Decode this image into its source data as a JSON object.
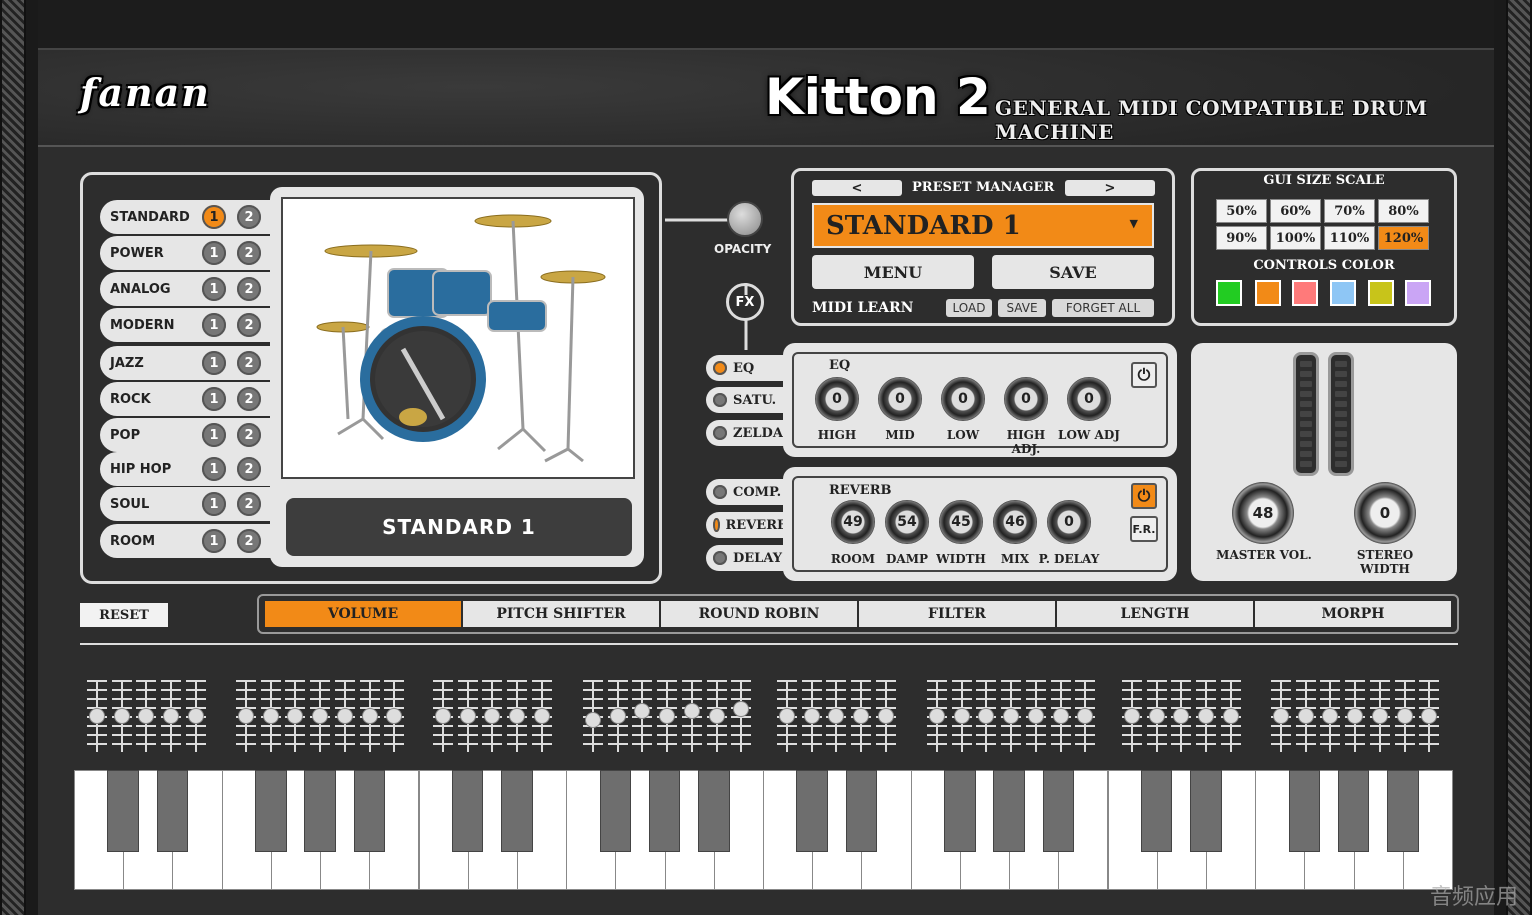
{
  "header": {
    "brand": "fanan",
    "title": "Kitton 2",
    "subtitle": "GENERAL MIDI COMPATIBLE DRUM MACHINE"
  },
  "kits": [
    {
      "label": "STANDARD",
      "active": 1
    },
    {
      "label": "POWER",
      "active": 0
    },
    {
      "label": "ANALOG",
      "active": 0
    },
    {
      "label": "MODERN",
      "active": 0
    },
    {
      "label": "JAZZ",
      "active": 0
    },
    {
      "label": "ROCK",
      "active": 0
    },
    {
      "label": "POP",
      "active": 0
    },
    {
      "label": "HIP HOP",
      "active": 0
    },
    {
      "label": "SOUL",
      "active": 0
    },
    {
      "label": "ROOM",
      "active": 0
    }
  ],
  "kit_variant_1": "1",
  "kit_variant_2": "2",
  "kit_display": "STANDARD 1",
  "opacity_label": "OPACITY",
  "fx_button": "FX",
  "preset": {
    "prev": "<",
    "next": ">",
    "title": "PRESET MANAGER",
    "selected": "STANDARD 1",
    "caret": "▼",
    "menu": "MENU",
    "save": "SAVE",
    "midi_learn": "MIDI LEARN",
    "load_small": "LOAD",
    "save_small": "SAVE",
    "forget_all": "FORGET ALL"
  },
  "gui_scale": {
    "title": "GUI SIZE SCALE",
    "options": [
      "50%",
      "60%",
      "70%",
      "80%",
      "90%",
      "100%",
      "110%",
      "120%"
    ],
    "selected": "120%",
    "colors_title": "CONTROLS COLOR",
    "colors": [
      "#22cc22",
      "#f28a17",
      "#ff7a7a",
      "#8ec6f5",
      "#c8c41a",
      "#caa5f5"
    ]
  },
  "fx_tabs": [
    {
      "label": "EQ",
      "on": true
    },
    {
      "label": "SATU.",
      "on": false
    },
    {
      "label": "ZELDA",
      "on": false
    },
    {
      "label": "COMP.",
      "on": false
    },
    {
      "label": "REVERB",
      "on": true
    },
    {
      "label": "DELAY",
      "on": false
    }
  ],
  "eq": {
    "name": "EQ",
    "power": "⏻",
    "knobs": [
      {
        "label": "HIGH",
        "value": "0"
      },
      {
        "label": "MID",
        "value": "0"
      },
      {
        "label": "LOW",
        "value": "0"
      },
      {
        "label": "HIGH ADJ.",
        "value": "0"
      },
      {
        "label": "LOW ADJ",
        "value": "0"
      }
    ]
  },
  "reverb": {
    "name": "REVERB",
    "power": "⏻",
    "fr": "F.R.",
    "knobs": [
      {
        "label": "ROOM",
        "value": "49"
      },
      {
        "label": "DAMP",
        "value": "54"
      },
      {
        "label": "WIDTH",
        "value": "45"
      },
      {
        "label": "MIX",
        "value": "46"
      },
      {
        "label": "P. DELAY",
        "value": "0"
      }
    ]
  },
  "master": {
    "volume_label": "MASTER VOL.",
    "volume_value": "48",
    "width_label": "STEREO WIDTH",
    "width_value": "0"
  },
  "reset": "RESET",
  "tabs": [
    {
      "label": "VOLUME",
      "on": true
    },
    {
      "label": "PITCH SHIFTER",
      "on": false
    },
    {
      "label": "ROUND ROBIN",
      "on": false
    },
    {
      "label": "FILTER",
      "on": false
    },
    {
      "label": "LENGTH",
      "on": false
    },
    {
      "label": "MORPH",
      "on": false
    }
  ],
  "watermark": "音频应用",
  "accent": "#f28a17"
}
